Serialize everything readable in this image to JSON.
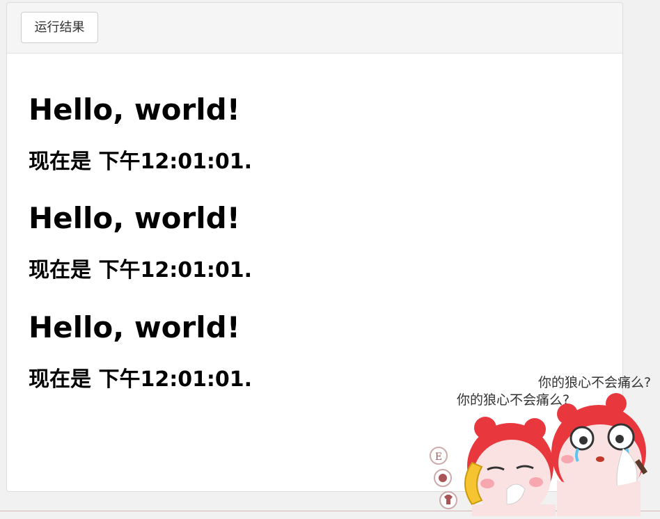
{
  "toolbar": {
    "run_label": "运行结果"
  },
  "output": {
    "blocks": [
      {
        "greeting": "Hello, world!",
        "time_line": "现在是 下午12:01:01."
      },
      {
        "greeting": "Hello, world!",
        "time_line": "现在是 下午12:01:01."
      },
      {
        "greeting": "Hello, world!",
        "time_line": "现在是 下午12:01:01."
      }
    ]
  },
  "sticker": {
    "caption_back": "你的狼心不会痛么?",
    "caption_front": "你的狼心不会痛么?",
    "side_icons": [
      "E",
      "●",
      "T"
    ]
  },
  "colors": {
    "panel_header_bg": "#f5f5f5",
    "panel_border": "#dcdcdc",
    "sticker_red": "#e8383d"
  }
}
